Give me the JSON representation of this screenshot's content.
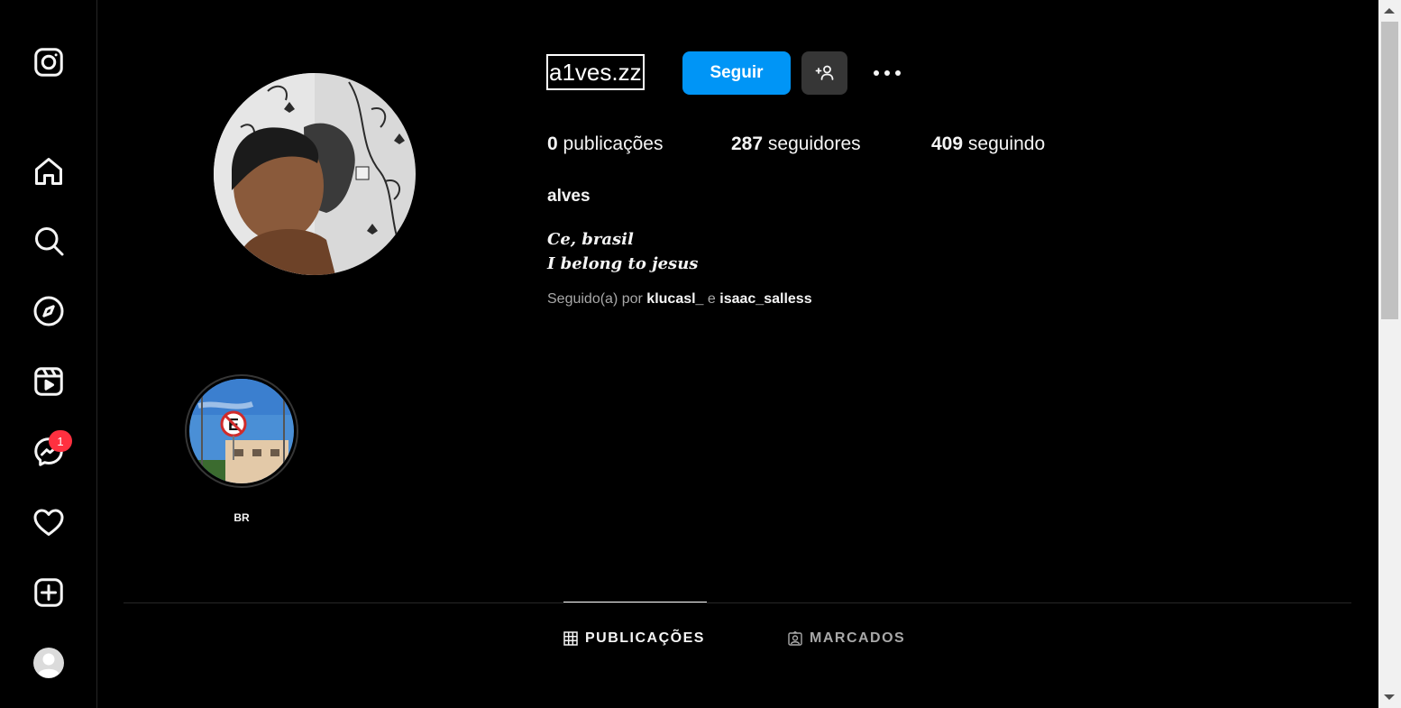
{
  "sidebar": {
    "icons": [
      "instagram-logo-icon",
      "home-icon",
      "search-icon",
      "explore-icon",
      "reels-icon",
      "messenger-icon",
      "heart-icon",
      "create-icon",
      "profile-avatar"
    ],
    "messages_badge": "1"
  },
  "profile": {
    "username": "a1ves.zz",
    "follow_label": "Seguir",
    "stats": {
      "posts_count": "0",
      "posts_label": "publicações",
      "followers_count": "287",
      "followers_label": "seguidores",
      "following_count": "409",
      "following_label": "seguindo"
    },
    "full_name": "alves",
    "bio_lines": [
      "Ce, brasil",
      "I belong to jesus"
    ],
    "followed_by": {
      "prefix": "Seguido(a) por",
      "account_1": "klucasl_",
      "separator": "e",
      "account_2": "isaac_salless"
    }
  },
  "highlights": [
    {
      "label": "BR"
    }
  ],
  "tabs": [
    {
      "label": "PUBLICAÇÕES",
      "active": true
    },
    {
      "label": "MARCADOS",
      "active": false
    }
  ],
  "colors": {
    "background": "#000000",
    "accent": "#0095f6",
    "badge": "#ff3040"
  }
}
